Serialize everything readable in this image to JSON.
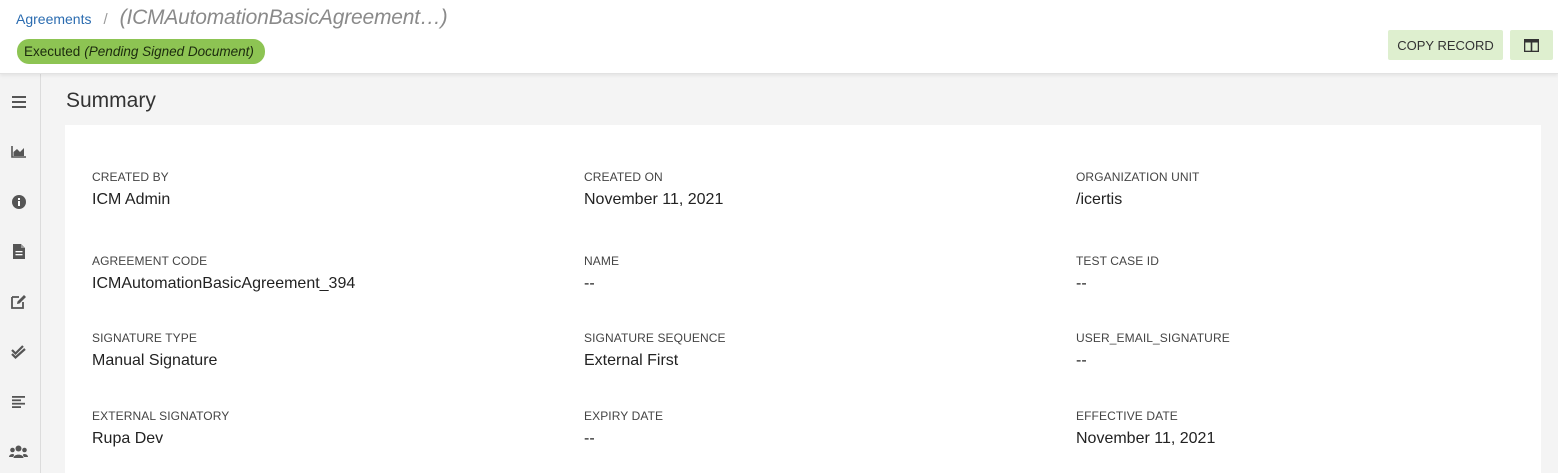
{
  "breadcrumb": {
    "parent": "Agreements",
    "separator": "/",
    "current": "(ICMAutomationBasicAgreement…)"
  },
  "status": {
    "label": "Executed",
    "sublabel": "(Pending Signed Document)",
    "color": "#8dc453"
  },
  "toolbar": {
    "copy_record_label": "COPY RECORD",
    "layout_icon": "columns-icon"
  },
  "sidebar": {
    "items": [
      {
        "icon": "menu-icon"
      },
      {
        "icon": "chart-icon"
      },
      {
        "icon": "info-icon"
      },
      {
        "icon": "document-icon"
      },
      {
        "icon": "edit-icon"
      },
      {
        "icon": "double-check-icon"
      },
      {
        "icon": "list-icon"
      },
      {
        "icon": "users-icon"
      }
    ]
  },
  "summary": {
    "title": "Summary",
    "fields": [
      {
        "label": "CREATED BY",
        "value": "ICM Admin"
      },
      {
        "label": "CREATED ON",
        "value": "November 11, 2021"
      },
      {
        "label": "ORGANIZATION UNIT",
        "value": "/icertis"
      },
      {
        "label": "AGREEMENT CODE",
        "value": "ICMAutomationBasicAgreement_394"
      },
      {
        "label": "NAME",
        "value": "--"
      },
      {
        "label": "TEST CASE ID",
        "value": "--"
      },
      {
        "label": "SIGNATURE TYPE",
        "value": "Manual Signature"
      },
      {
        "label": "SIGNATURE SEQUENCE",
        "value": "External First"
      },
      {
        "label": "USER_EMAIL_SIGNATURE",
        "value": "--"
      },
      {
        "label": "EXTERNAL SIGNATORY",
        "value": "Rupa Dev"
      },
      {
        "label": "EXPIRY DATE",
        "value": "--"
      },
      {
        "label": "EFFECTIVE DATE",
        "value": "November 11, 2021"
      }
    ]
  }
}
